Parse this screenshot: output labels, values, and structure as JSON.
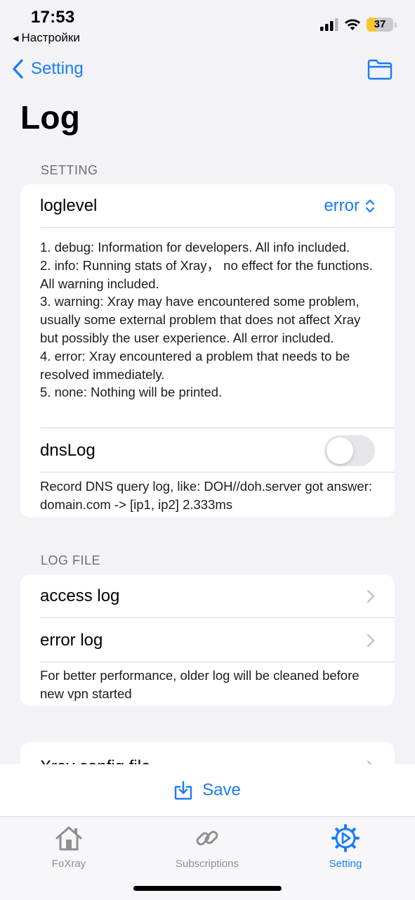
{
  "status": {
    "time": "17:53",
    "back_app": "Настройки",
    "battery": "37",
    "battery_level": 0.37
  },
  "nav": {
    "back_label": "Setting"
  },
  "title": "Log",
  "setting_section": {
    "header": "SETTING",
    "loglevel_label": "loglevel",
    "loglevel_value": "error",
    "loglevel_note": "1. debug: Information for developers. All info included.\n2. info: Running stats of Xray， no effect for the functions. All warning included.\n3. warning: Xray may have encountered some problem, usually some external problem that does not affect Xray but possibly the user experience. All error included.\n4. error: Xray encountered a problem that needs to be resolved immediately.\n5. none: Nothing will be printed.",
    "dnslog_label": "dnsLog",
    "dnslog_enabled": false,
    "dnslog_note": "Record DNS query log, like: DOH//doh.server got answer: domain.com -> [ip1, ip2] 2.333ms"
  },
  "logfile_section": {
    "header": "LOG FILE",
    "access_log": "access log",
    "error_log": "error log",
    "note": "For better performance, older log will be cleaned before new vpn started"
  },
  "config_section": {
    "xray_config": "Xray config file"
  },
  "save_label": "Save",
  "tabs": [
    {
      "label": "FoXray",
      "icon": "house-icon"
    },
    {
      "label": "Subscriptions",
      "icon": "link-icon"
    },
    {
      "label": "Setting",
      "icon": "gear-icon"
    }
  ],
  "colors": {
    "accent": "#1a7cf5",
    "background": "#f2f2f7",
    "battery": "#f5c830"
  }
}
